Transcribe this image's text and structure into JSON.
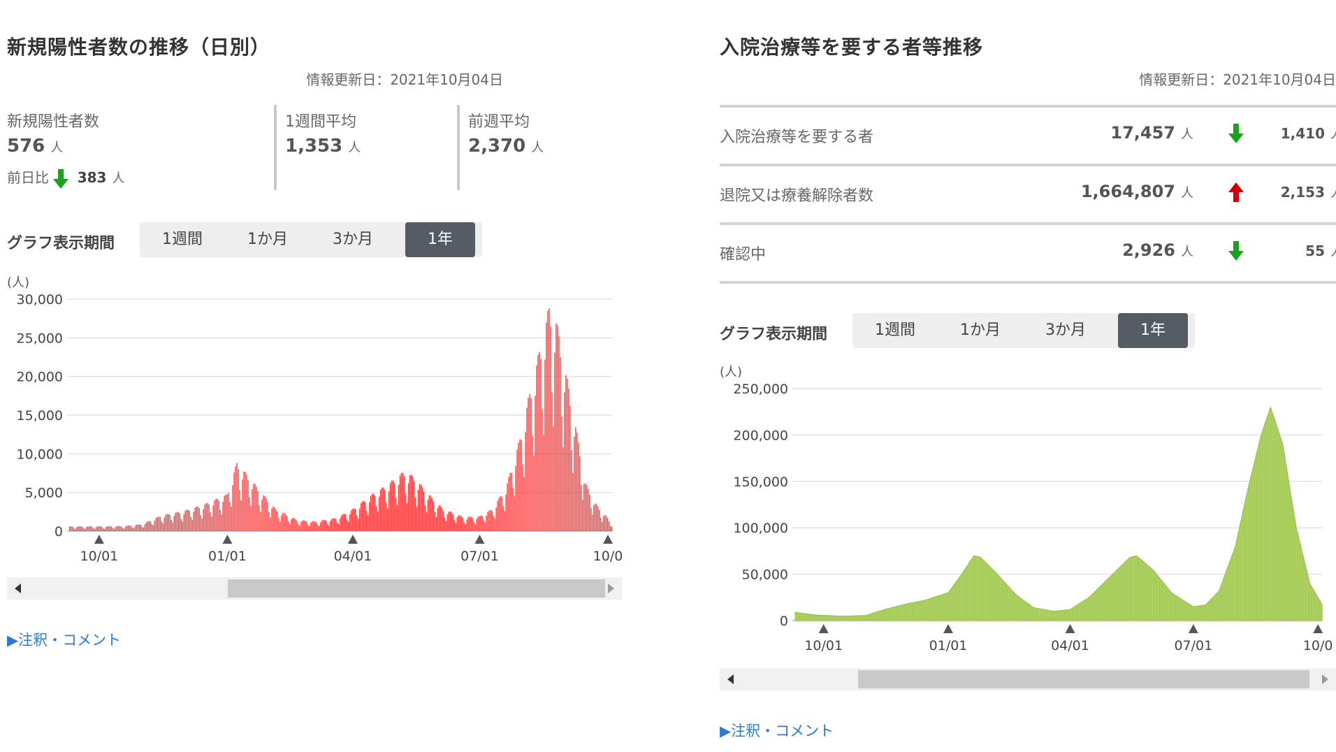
{
  "left": {
    "title": "新規陽性者数の推移（日別）",
    "updated": "情報更新日：2021年10月04日",
    "stats": [
      {
        "label": "新規陽性者数",
        "value": "576",
        "unit": "人"
      },
      {
        "label": "1週間平均",
        "value": "1,353",
        "unit": "人"
      },
      {
        "label": "前週平均",
        "value": "2,370",
        "unit": "人"
      }
    ],
    "diff": {
      "label": "前日比",
      "value": "383",
      "unit": "人",
      "direction": "down"
    },
    "period_label": "グラフ表示期間",
    "tabs": [
      "1週間",
      "1か月",
      "3か月",
      "1年"
    ],
    "active_tab": "1年",
    "note": "▶注釈・コメント"
  },
  "right": {
    "title": "入院治療等を要する者等推移",
    "updated": "情報更新日：2021年10月04日",
    "rows": [
      {
        "label": "入院治療等を要する者",
        "value": "17,457",
        "unit": "人",
        "direction": "down",
        "diff": "1,410",
        "diff_unit": "人"
      },
      {
        "label": "退院又は療養解除者数",
        "value": "1,664,807",
        "unit": "人",
        "direction": "up",
        "diff": "2,153",
        "diff_unit": "人"
      },
      {
        "label": "確認中",
        "value": "2,926",
        "unit": "人",
        "direction": "down",
        "diff": "55",
        "diff_unit": "人"
      }
    ],
    "period_label": "グラフ表示期間",
    "tabs": [
      "1週間",
      "1か月",
      "3か月",
      "1年"
    ],
    "active_tab": "1年",
    "note": "▶注釈・コメント"
  },
  "colors": {
    "bars": "#ff3b3b",
    "area": "#a8cc5a",
    "arrow_down": "#1aa31a",
    "arrow_up": "#d10000",
    "active_tab": "#555b62"
  },
  "chart_data": [
    {
      "type": "bar",
      "unit_label": "(人)",
      "ylim": [
        0,
        30000
      ],
      "yticks": [
        "0",
        "5,000",
        "10,000",
        "15,000",
        "20,000",
        "25,000",
        "30,000"
      ],
      "xticks": [
        {
          "date": "2020-10-01",
          "label": "10/01"
        },
        {
          "date": "2021-01-01",
          "label": "01/01"
        },
        {
          "date": "2021-04-01",
          "label": "04/01"
        },
        {
          "date": "2021-07-01",
          "label": "07/01"
        },
        {
          "date": "2021-10-01",
          "label": "10/0"
        }
      ],
      "x_range": [
        "2020-09-10",
        "2021-10-04"
      ],
      "grid": true,
      "series": [
        {
          "color": "#ff3b3b",
          "keypoints": [
            [
              "2020-09-10",
              550
            ],
            [
              "2020-10-01",
              550
            ],
            [
              "2020-10-20",
              600
            ],
            [
              "2020-11-01",
              800
            ],
            [
              "2020-11-15",
              1800
            ],
            [
              "2020-12-01",
              2300
            ],
            [
              "2020-12-15",
              3000
            ],
            [
              "2021-01-01",
              4200
            ],
            [
              "2021-01-08",
              7800
            ],
            [
              "2021-01-15",
              6500
            ],
            [
              "2021-01-25",
              4500
            ],
            [
              "2021-02-05",
              2500
            ],
            [
              "2021-02-20",
              1300
            ],
            [
              "2021-03-05",
              1100
            ],
            [
              "2021-03-20",
              1500
            ],
            [
              "2021-04-01",
              2500
            ],
            [
              "2021-04-15",
              4200
            ],
            [
              "2021-04-25",
              5200
            ],
            [
              "2021-05-08",
              6800
            ],
            [
              "2021-05-15",
              6200
            ],
            [
              "2021-05-25",
              4300
            ],
            [
              "2021-06-05",
              2500
            ],
            [
              "2021-06-20",
              1600
            ],
            [
              "2021-07-01",
              1700
            ],
            [
              "2021-07-10",
              2500
            ],
            [
              "2021-07-20",
              5000
            ],
            [
              "2021-07-30",
              10500
            ],
            [
              "2021-08-05",
              15000
            ],
            [
              "2021-08-13",
              20500
            ],
            [
              "2021-08-20",
              25500
            ],
            [
              "2021-08-25",
              24000
            ],
            [
              "2021-09-01",
              18000
            ],
            [
              "2021-09-08",
              12000
            ],
            [
              "2021-09-15",
              5500
            ],
            [
              "2021-09-22",
              3200
            ],
            [
              "2021-10-01",
              1500
            ],
            [
              "2021-10-04",
              576
            ]
          ]
        }
      ]
    },
    {
      "type": "area",
      "unit_label": "(人)",
      "ylim": [
        0,
        250000
      ],
      "yticks": [
        "0",
        "50,000",
        "100,000",
        "150,000",
        "200,000",
        "250,000"
      ],
      "xticks": [
        {
          "date": "2020-10-01",
          "label": "10/01"
        },
        {
          "date": "2021-01-01",
          "label": "01/01"
        },
        {
          "date": "2021-04-01",
          "label": "04/01"
        },
        {
          "date": "2021-07-01",
          "label": "07/01"
        },
        {
          "date": "2021-10-01",
          "label": "10/0"
        }
      ],
      "x_range": [
        "2020-09-10",
        "2021-10-04"
      ],
      "grid": true,
      "series": [
        {
          "color": "#a8cc5a",
          "keypoints": [
            [
              "2020-09-10",
              9000
            ],
            [
              "2020-09-25",
              6000
            ],
            [
              "2020-10-15",
              4800
            ],
            [
              "2020-11-01",
              5500
            ],
            [
              "2020-11-15",
              12000
            ],
            [
              "2020-12-01",
              18000
            ],
            [
              "2020-12-15",
              22000
            ],
            [
              "2021-01-01",
              30000
            ],
            [
              "2021-01-10",
              48000
            ],
            [
              "2021-01-20",
              70000
            ],
            [
              "2021-01-25",
              68000
            ],
            [
              "2021-02-05",
              52000
            ],
            [
              "2021-02-20",
              28000
            ],
            [
              "2021-03-05",
              14000
            ],
            [
              "2021-03-20",
              10000
            ],
            [
              "2021-04-01",
              12000
            ],
            [
              "2021-04-15",
              25000
            ],
            [
              "2021-05-01",
              48000
            ],
            [
              "2021-05-15",
              68000
            ],
            [
              "2021-05-20",
              70000
            ],
            [
              "2021-06-01",
              55000
            ],
            [
              "2021-06-15",
              30000
            ],
            [
              "2021-07-01",
              15000
            ],
            [
              "2021-07-10",
              17000
            ],
            [
              "2021-07-20",
              32000
            ],
            [
              "2021-08-01",
              80000
            ],
            [
              "2021-08-10",
              140000
            ],
            [
              "2021-08-20",
              200000
            ],
            [
              "2021-08-27",
              230000
            ],
            [
              "2021-09-05",
              190000
            ],
            [
              "2021-09-15",
              100000
            ],
            [
              "2021-09-25",
              40000
            ],
            [
              "2021-10-04",
              17457
            ]
          ]
        }
      ]
    }
  ]
}
